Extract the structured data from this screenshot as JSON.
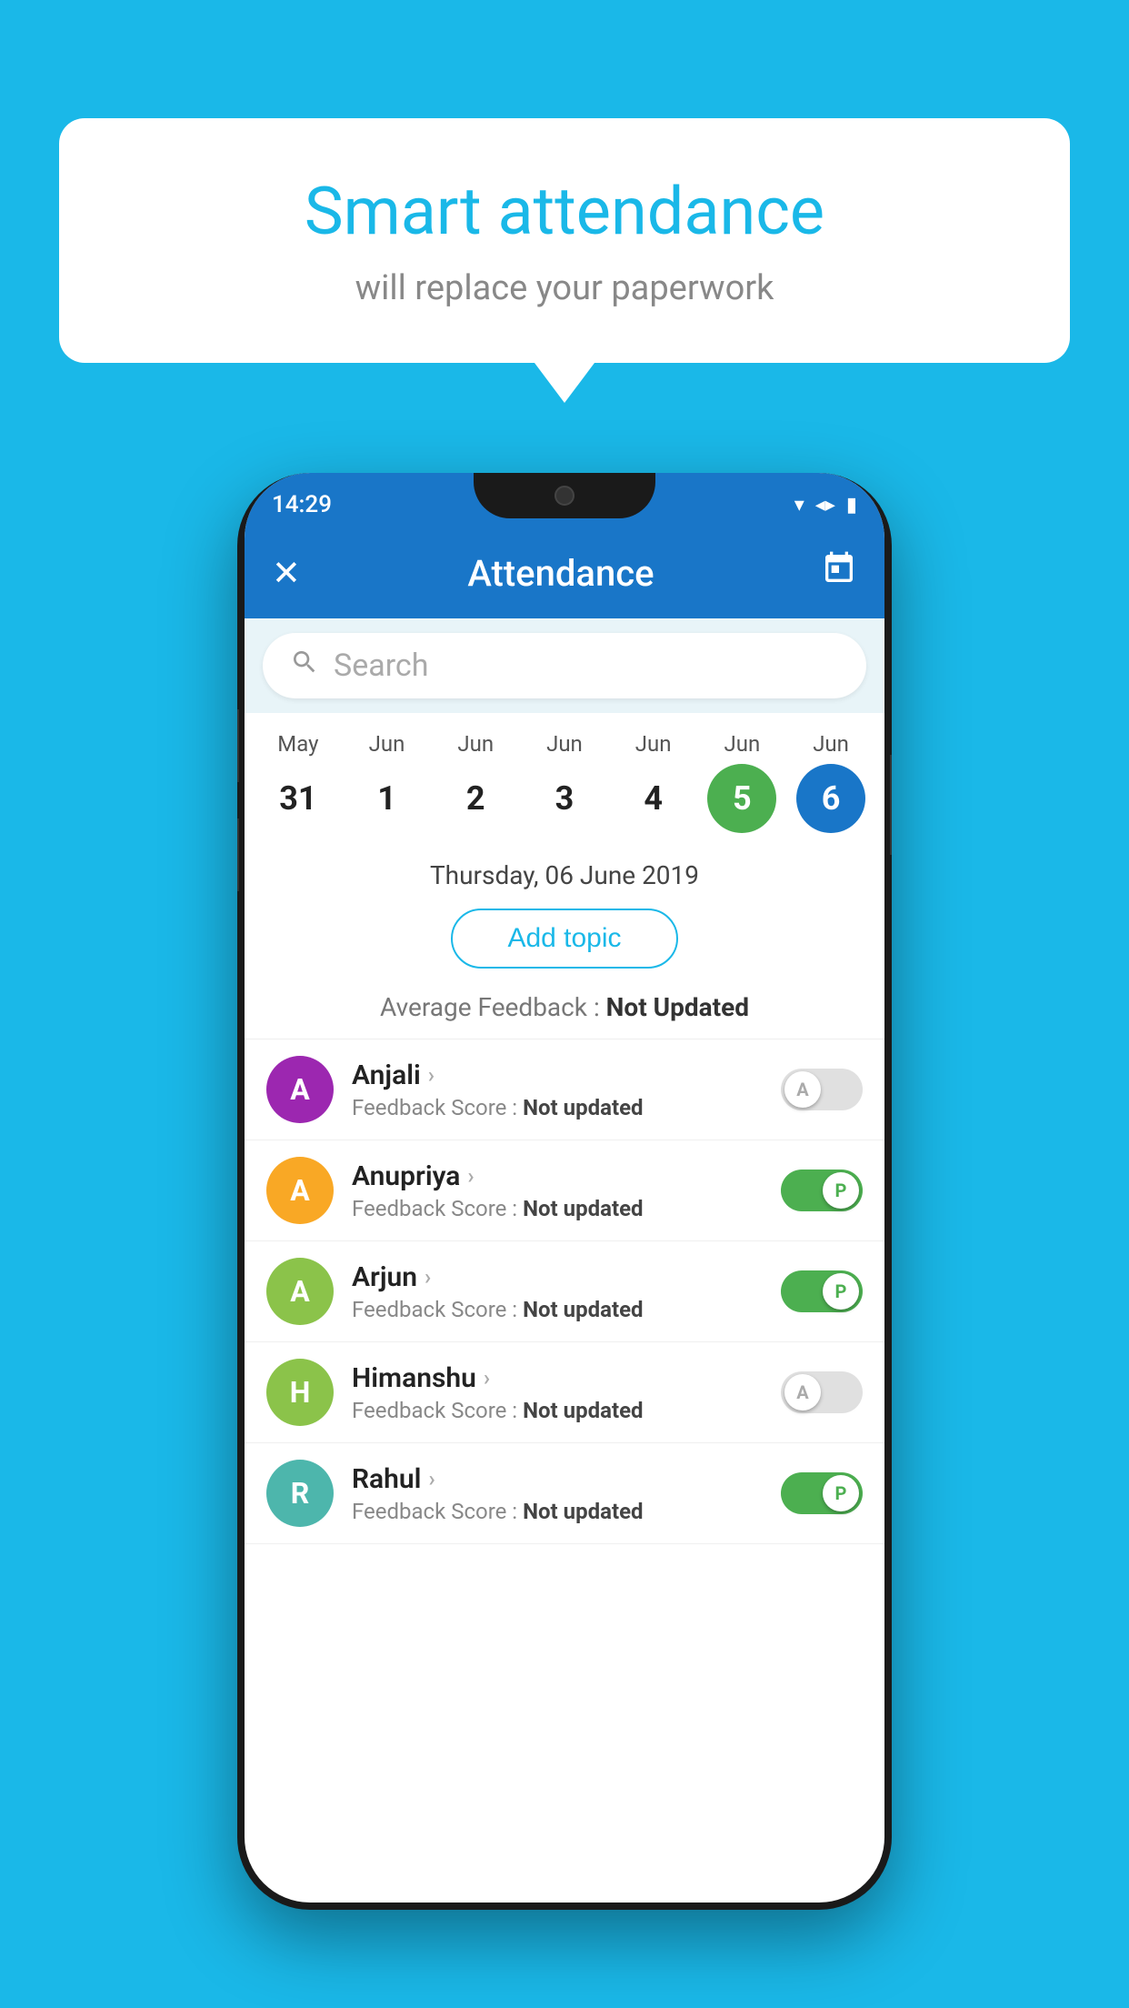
{
  "background_color": "#1ab8e8",
  "bubble": {
    "title": "Smart attendance",
    "subtitle": "will replace your paperwork"
  },
  "status_bar": {
    "time": "14:29",
    "wifi": "▾",
    "signal": "▲",
    "battery": "▮"
  },
  "app_bar": {
    "title": "Attendance",
    "close_label": "✕",
    "calendar_label": "📅"
  },
  "search": {
    "placeholder": "Search"
  },
  "calendar": {
    "days": [
      {
        "month": "May",
        "date": "31",
        "state": "normal"
      },
      {
        "month": "Jun",
        "date": "1",
        "state": "normal"
      },
      {
        "month": "Jun",
        "date": "2",
        "state": "normal"
      },
      {
        "month": "Jun",
        "date": "3",
        "state": "normal"
      },
      {
        "month": "Jun",
        "date": "4",
        "state": "normal"
      },
      {
        "month": "Jun",
        "date": "5",
        "state": "today"
      },
      {
        "month": "Jun",
        "date": "6",
        "state": "selected"
      }
    ]
  },
  "selected_date": "Thursday, 06 June 2019",
  "add_topic_label": "Add topic",
  "avg_feedback": {
    "label": "Average Feedback : ",
    "value": "Not Updated"
  },
  "students": [
    {
      "name": "Anjali",
      "avatar_letter": "A",
      "avatar_color": "#9c27b0",
      "feedback_label": "Feedback Score : ",
      "feedback_value": "Not updated",
      "toggle_state": "off",
      "toggle_letter": "A"
    },
    {
      "name": "Anupriya",
      "avatar_letter": "A",
      "avatar_color": "#f9a825",
      "feedback_label": "Feedback Score : ",
      "feedback_value": "Not updated",
      "toggle_state": "on",
      "toggle_letter": "P"
    },
    {
      "name": "Arjun",
      "avatar_letter": "A",
      "avatar_color": "#8bc34a",
      "feedback_label": "Feedback Score : ",
      "feedback_value": "Not updated",
      "toggle_state": "on",
      "toggle_letter": "P"
    },
    {
      "name": "Himanshu",
      "avatar_letter": "H",
      "avatar_color": "#8bc34a",
      "feedback_label": "Feedback Score : ",
      "feedback_value": "Not updated",
      "toggle_state": "off",
      "toggle_letter": "A"
    },
    {
      "name": "Rahul",
      "avatar_letter": "R",
      "avatar_color": "#4db6ac",
      "feedback_label": "Feedback Score : ",
      "feedback_value": "Not updated",
      "toggle_state": "on",
      "toggle_letter": "P"
    }
  ]
}
